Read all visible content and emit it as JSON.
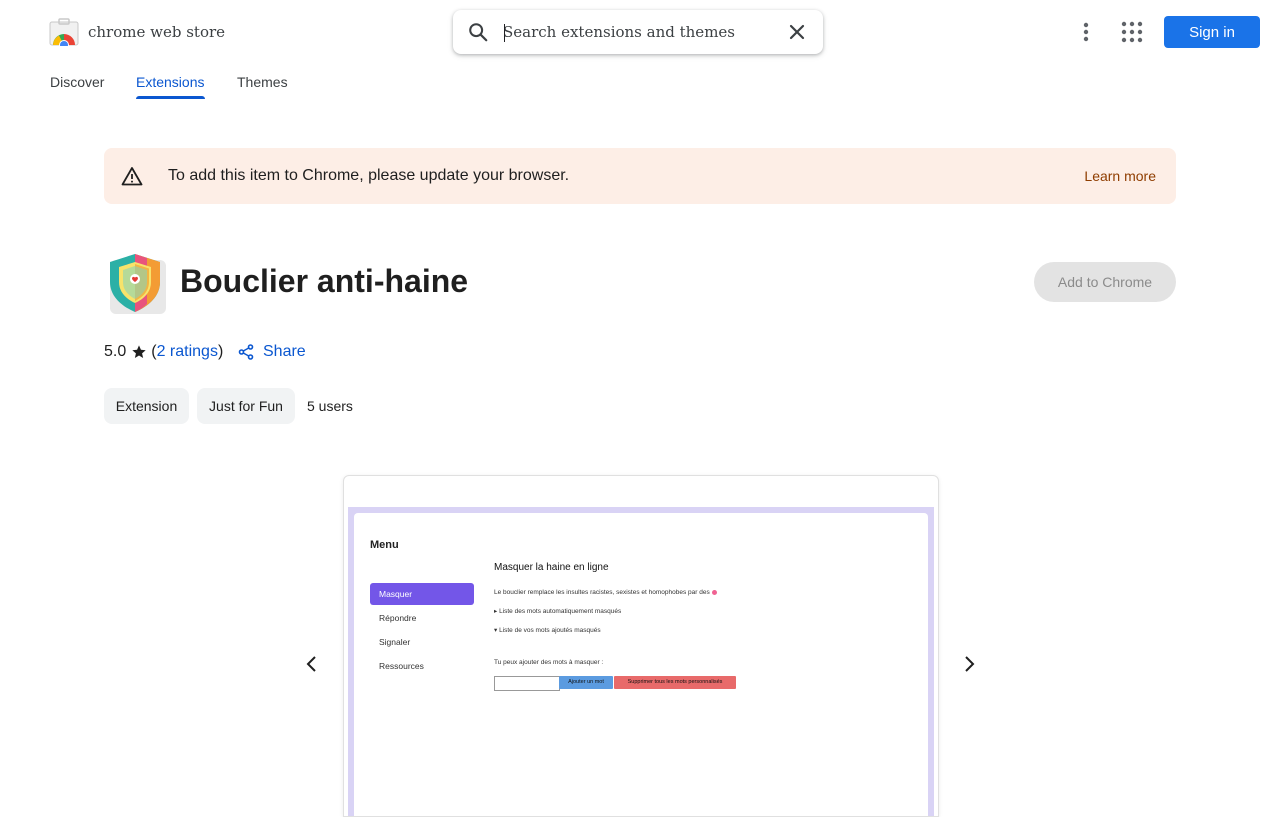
{
  "header": {
    "store_name": "chrome web store",
    "search_placeholder": "Search extensions and themes",
    "sign_in": "Sign in"
  },
  "nav": {
    "tabs": [
      {
        "label": "Discover",
        "active": false
      },
      {
        "label": "Extensions",
        "active": true
      },
      {
        "label": "Themes",
        "active": false
      }
    ]
  },
  "banner": {
    "message": "To add this item to Chrome, please update your browser.",
    "learn_more": "Learn more"
  },
  "extension": {
    "title": "Bouclier anti-haine",
    "add_button": "Add to Chrome",
    "rating": "5.0",
    "ratings_count": "2 ratings",
    "share": "Share",
    "chips": [
      "Extension",
      "Just for Fun"
    ],
    "users": "5 users"
  },
  "screenshot": {
    "menu_title": "Menu",
    "menu_items": [
      "Masquer",
      "Répondre",
      "Signaler",
      "Ressources"
    ],
    "panel_title": "Masquer la haine en ligne",
    "line1": "Le bouclier remplace les insultes racistes, sexistes et homophobes par des",
    "line2": "▸ Liste des mots automatiquement masqués",
    "line3": "▾ Liste de vos mots ajoutés masqués",
    "line4": "Tu peux ajouter des mots à masquer :",
    "add_word_button": "Ajouter un mot",
    "delete_button": "Supprimer tous les mots personnalisés"
  },
  "colors": {
    "accent": "#0b57d0",
    "signin_bg": "#1a73e8",
    "banner_bg": "#fdeee6",
    "learn_more": "#8f3d00"
  }
}
